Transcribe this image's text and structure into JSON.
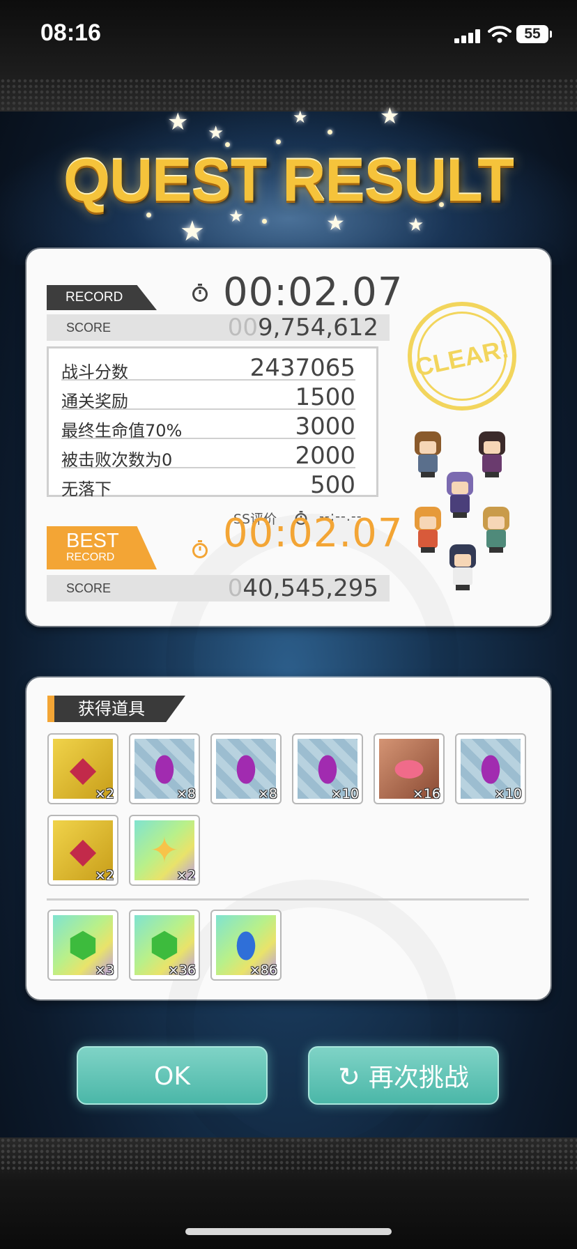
{
  "status_bar": {
    "time": "08:16",
    "battery": "55"
  },
  "banner": {
    "title": "QUEST RESULT"
  },
  "record": {
    "tag": "RECORD",
    "time": "00:02.07",
    "score_label": "SCORE",
    "score_prefix": "00",
    "score_value": "9,754,612",
    "breakdown": [
      {
        "label": "战斗分数",
        "value": "2437065"
      },
      {
        "label": "通关奖励",
        "value": "1500"
      },
      {
        "label": "最终生命值70%",
        "value": "3000"
      },
      {
        "label": "被击败次数为0",
        "value": "2000"
      },
      {
        "label": "无落下",
        "value": "500"
      }
    ],
    "ss_label": "SS评价",
    "ss_time": "--:--.--",
    "clear_stamp": "CLEAR!"
  },
  "best": {
    "tag_line1": "BEST",
    "tag_line2": "RECORD",
    "time": "00:02.07",
    "score_label": "SCORE",
    "score_prefix": "0",
    "score_value": "40,545,295"
  },
  "items": {
    "title": "获得道具",
    "row1": [
      {
        "icon": "red-crystal-icon",
        "qty": "×2"
      },
      {
        "icon": "purple-drop-icon",
        "qty": "×8"
      },
      {
        "icon": "purple-drop-icon",
        "qty": "×8"
      },
      {
        "icon": "purple-drop-icon",
        "qty": "×10"
      },
      {
        "icon": "pink-gem-icon",
        "qty": "×16"
      },
      {
        "icon": "purple-drop-icon",
        "qty": "×10"
      }
    ],
    "row2": [
      {
        "icon": "red-crystal-icon",
        "qty": "×2"
      },
      {
        "icon": "gold-star-icon",
        "qty": "×2"
      }
    ],
    "row3": [
      {
        "icon": "green-gem-icon",
        "qty": "×3"
      },
      {
        "icon": "green-gem-icon",
        "qty": "×36"
      },
      {
        "icon": "blue-drop-icon",
        "qty": "×86"
      }
    ]
  },
  "buttons": {
    "ok": "OK",
    "retry": "再次挑战"
  },
  "colors": {
    "accent_orange": "#f3a535",
    "button_teal": "#5cc3b4",
    "title_gold": "#f5c33b"
  }
}
